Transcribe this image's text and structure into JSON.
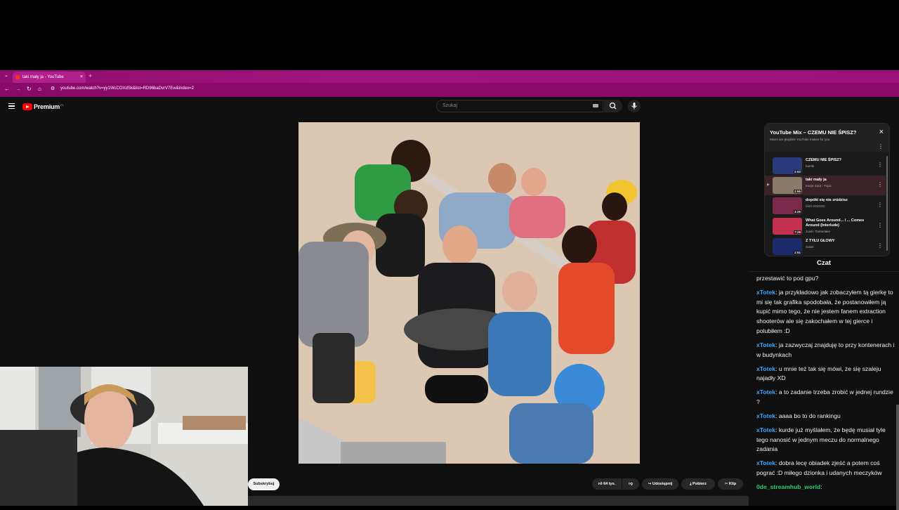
{
  "browser": {
    "tab_title": "taki mały ja - YouTube",
    "tab_close": "×",
    "new_tab": "+",
    "tab_menu": "⌄",
    "url": "youtube.com/watch?v=yy1WcCOXdSk&list=RD96baDvrV7Ew&index=2"
  },
  "youtube": {
    "logo_text": "Premium",
    "logo_region": "PL",
    "search_placeholder": "Szukaj"
  },
  "playlist": {
    "title": "YouTube Mix – CZEMU NIE ŚPISZ?",
    "subtitle": "Mixes are playlists YouTube makes for you",
    "close": "×",
    "more": "⋮",
    "items": [
      {
        "title": "CZEMU NIE ŚPISZ?",
        "artist": "bambi",
        "duration": "2:53",
        "active": false,
        "thumb_color": "#2a3a7a"
      },
      {
        "title": "taki mały ja",
        "artist": "Kaeje 2115 - Topic",
        "duration": "2:55",
        "active": true,
        "thumb_color": "#8a7a6a"
      },
      {
        "title": "dopóki się nie zrüdzisz",
        "artist": "білб ООООО",
        "duration": "3:25",
        "active": false,
        "thumb_color": "#7a2a4a"
      },
      {
        "title": "What Goes Around... / ... Comes Around (Interlude)",
        "artist": "Justin Timberlake",
        "duration": "7:29",
        "active": false,
        "thumb_color": "#c43050"
      },
      {
        "title": "Z TYŁU GŁOWY",
        "artist": "Sobel",
        "duration": "2:51",
        "active": false,
        "thumb_color": "#1a2a6a"
      }
    ]
  },
  "chat": {
    "title": "Czat",
    "messages": [
      {
        "nick": "",
        "text": "przestawić to pod gpu?"
      },
      {
        "nick": "xTotek",
        "text": ": ja przykładowo jak zobaczyłem tą gierkę to mi się tak grafika spodobała, że postanowiłem ją kupić mimo tego, że nie jestem fanem extraction shooterów ale się zakochałem w tej gierce i polubiłem :D"
      },
      {
        "nick": "xTotek",
        "text": ": ja zazwyczaj znajduję to przy kontenerach i w budynkach"
      },
      {
        "nick": "xTotek",
        "text": ": u mnie też tak się mówi, że się szaleju najadły XD"
      },
      {
        "nick": "xTotek",
        "text": ": a to zadanie trzeba zrobić w jednej rundzie ?"
      },
      {
        "nick": "xTotek",
        "text": ": aaaa bo to do rankingu"
      },
      {
        "nick": "xTotek",
        "text": ": kurde już myślałem, że będę musiał tyle tego nanosić w jednym meczu do normalnego zadania"
      },
      {
        "nick": "xTotek",
        "text": ": dobra lecę obiadek zjeść a potem coś pograć :D miłego dzionka i udanych meczyków"
      },
      {
        "nick": "0de_streamhub_world",
        "text": ":",
        "green": true
      }
    ]
  },
  "actions": {
    "subscribe": "Subskrybuj",
    "likes": "64 tys.",
    "share": "Udostępnij",
    "download": "Pobierz",
    "clip": "Klip"
  }
}
